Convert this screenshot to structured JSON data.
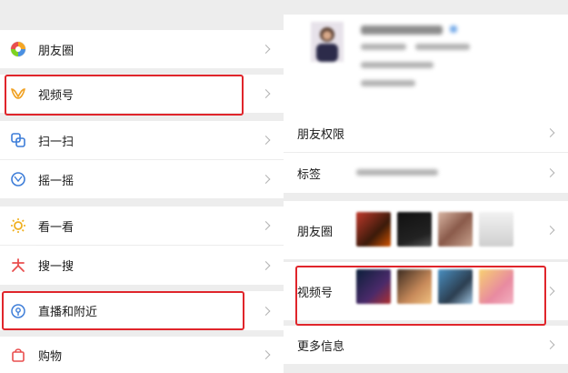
{
  "window": {
    "minimize": "—",
    "maximize": "☐",
    "close": "✕"
  },
  "discover_menu": {
    "items": [
      {
        "label": "朋友圈",
        "icon": "moments-icon"
      },
      {
        "label": "视频号",
        "icon": "channels-icon"
      },
      {
        "label": "扫一扫",
        "icon": "scan-icon"
      },
      {
        "label": "摇一摇",
        "icon": "shake-icon"
      },
      {
        "label": "看一看",
        "icon": "top-stories-icon"
      },
      {
        "label": "搜一搜",
        "icon": "search-icon"
      },
      {
        "label": "直播和附近",
        "icon": "live-nearby-icon"
      },
      {
        "label": "购物",
        "icon": "shopping-icon"
      }
    ]
  },
  "profile": {
    "rows": [
      {
        "label": "朋友权限"
      },
      {
        "label": "标签"
      },
      {
        "label": "朋友圈"
      },
      {
        "label": "视频号"
      },
      {
        "label": "更多信息"
      }
    ]
  },
  "colors": {
    "highlight": "#e0252b",
    "background": "#ededed"
  }
}
